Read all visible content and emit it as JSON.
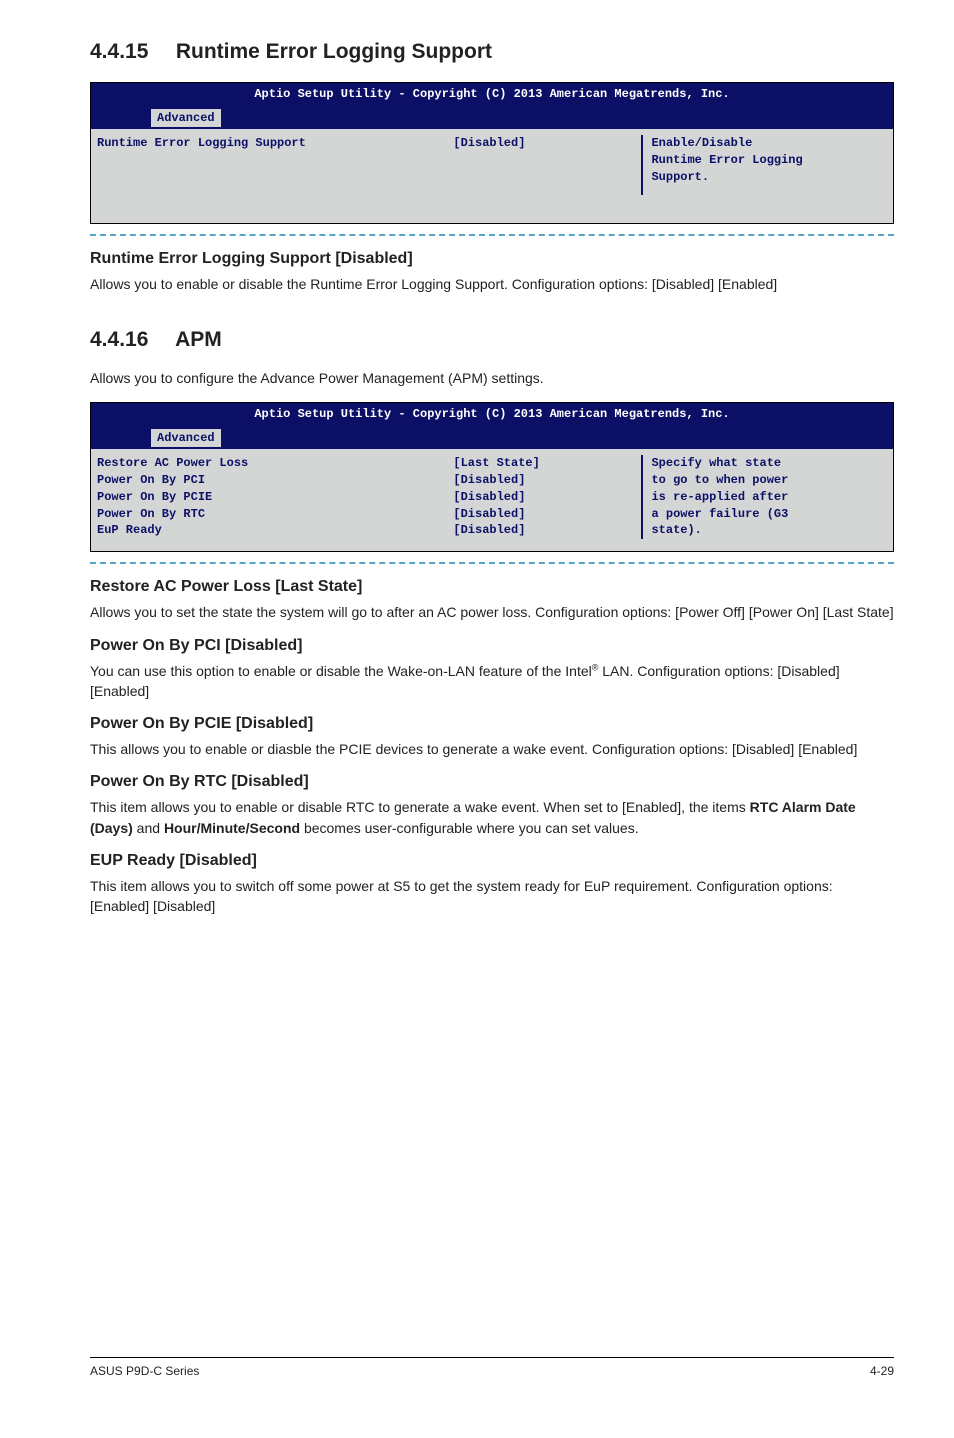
{
  "section1": {
    "num": "4.4.15",
    "title": "Runtime Error Logging Support"
  },
  "bios1": {
    "header": "Aptio Setup Utility - Copyright (C) 2013 American Megatrends, Inc.",
    "tab": "Advanced",
    "left": "Runtime Error Logging Support",
    "mid": "[Disabled]",
    "help1": "Enable/Disable",
    "help2": "Runtime Error Logging",
    "help3": "Support."
  },
  "setting1": {
    "head": "Runtime Error Logging Support [Disabled]",
    "body": "Allows you to enable or disable the Runtime Error Logging Support. Configuration options: [Disabled] [Enabled]"
  },
  "section2": {
    "num": "4.4.16",
    "title": "APM",
    "intro": "Allows you to configure the Advance Power Management (APM) settings."
  },
  "bios2": {
    "header": "Aptio Setup Utility - Copyright (C) 2013 American Megatrends, Inc.",
    "tab": "Advanced",
    "rows": [
      {
        "l": "Restore AC Power Loss",
        "m": "[Last State]"
      },
      {
        "l": "Power On By PCI",
        "m": "[Disabled]"
      },
      {
        "l": "Power On By PCIE",
        "m": "[Disabled]"
      },
      {
        "l": "Power On By RTC",
        "m": "[Disabled]"
      },
      {
        "l": "EuP Ready",
        "m": "[Disabled]"
      }
    ],
    "help1": "Specify what state",
    "help2": "to go to when power",
    "help3": "is re-applied after",
    "help4": "a power failure (G3",
    "help5": "state)."
  },
  "setting2": {
    "head": "Restore AC Power Loss [Last State]",
    "body": "Allows you to set the state the system will go to after an AC power loss. Configuration options: [Power Off] [Power On] [Last State]"
  },
  "setting3": {
    "head": "Power On By PCI [Disabled]",
    "body_a": "You can use this option to enable or disable the Wake-on-LAN feature of the Intel",
    "body_b": " LAN. Configuration options: [Disabled] [Enabled]"
  },
  "setting4": {
    "head": "Power On By PCIE [Disabled]",
    "body": "This allows you to enable or diasble the PCIE devices to generate a wake event. Configuration options: [Disabled] [Enabled]"
  },
  "setting5": {
    "head": "Power On By RTC [Disabled]",
    "body_a": "This item allows you to enable or disable RTC to generate a wake event. When set to [Enabled], the items ",
    "bold1": "RTC Alarm Date (Days)",
    "body_b": " and ",
    "bold2": "Hour/Minute/Second",
    "body_c": " becomes user-configurable where you can set values."
  },
  "setting6": {
    "head": "EUP Ready [Disabled]",
    "body": "This item allows you to switch off some power at S5 to get the system ready for EuP requirement. Configuration options: [Enabled] [Disabled]"
  },
  "footer": {
    "left": "ASUS P9D-C Series",
    "right": "4-29"
  }
}
